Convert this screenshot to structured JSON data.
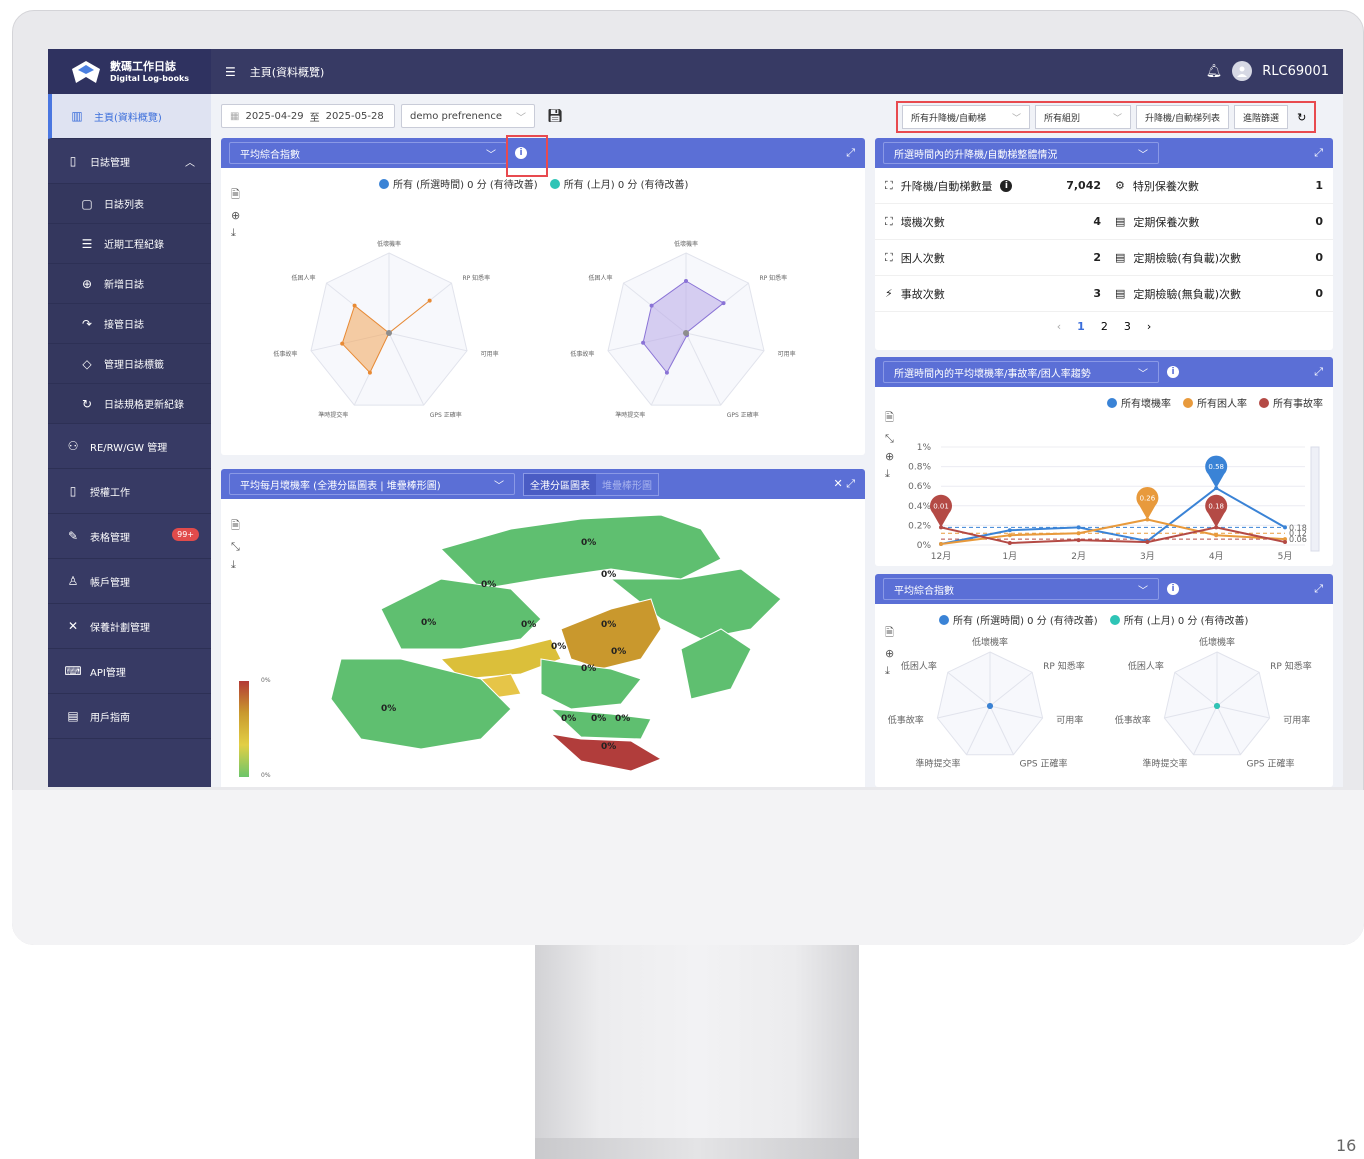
{
  "brand": {
    "title": "數碼工作日誌",
    "subtitle": "Digital Log-books"
  },
  "header": {
    "page_title": "主頁(資料概覽)",
    "user": "RLC69001"
  },
  "sidebar": {
    "items": [
      {
        "label": "主頁(資料概覽)"
      },
      {
        "label": "日誌管理"
      },
      {
        "label": "日誌列表"
      },
      {
        "label": "近期工程紀錄"
      },
      {
        "label": "新增日誌"
      },
      {
        "label": "接管日誌"
      },
      {
        "label": "管理日誌標籤"
      },
      {
        "label": "日誌規格更新紀錄"
      },
      {
        "label": "RE/RW/GW 管理"
      },
      {
        "label": "授權工作"
      },
      {
        "label": "表格管理"
      },
      {
        "label": "帳戶管理"
      },
      {
        "label": "保養計劃管理"
      },
      {
        "label": "API管理"
      },
      {
        "label": "用戶指南"
      }
    ],
    "forms_badge": "99+"
  },
  "toolbar": {
    "date_from": "2025-04-29",
    "date_sep": "至",
    "date_to": "2025-05-28",
    "preference": "demo prefrenence"
  },
  "filters": {
    "lift": "所有升降機/自動梯",
    "group": "所有組別",
    "list_btn": "升降機/自動梯列表",
    "advanced": "進階篩選"
  },
  "radar_panel": {
    "title": "平均綜合指數",
    "legend_a": "所有 (所選時間) 0 分 (有待改善)",
    "legend_b": "所有 (上月) 0 分 (有待改善)",
    "axes": [
      "低壞機率",
      "RP 知悉率",
      "可用率",
      "GPS 正確率",
      "準時提交率",
      "低事故率",
      "低困人率"
    ]
  },
  "map_panel": {
    "title": "平均每月壞機率 (全港分區圖表 | 堆疊棒形圖)",
    "tab_map": "全港分區圖表",
    "tab_bar": "堆疊棒形圖",
    "scale_top": "0%",
    "scale_bottom": "0%",
    "region_label": "0%"
  },
  "summary_panel": {
    "title": "所選時間內的升降機/自動梯整體情況",
    "rows": [
      {
        "l": "升降機/自動梯數量",
        "v": "7,042",
        "r": "特別保養次數",
        "rv": "1"
      },
      {
        "l": "壞機次數",
        "v": "4",
        "r": "定期保養次數",
        "rv": "0"
      },
      {
        "l": "困人次數",
        "v": "2",
        "r": "定期檢驗(有負載)次數",
        "rv": "0"
      },
      {
        "l": "事故次數",
        "v": "3",
        "r": "定期檢驗(無負載)次數",
        "rv": "0"
      }
    ],
    "pages": [
      "1",
      "2",
      "3"
    ]
  },
  "trend_panel": {
    "title": "所選時間內的平均壞機率/事故率/困人率趨勢",
    "legend": [
      "所有壞機率",
      "所有困人率",
      "所有事故率"
    ],
    "right_labels": [
      "0.18",
      "0.12",
      "0.06"
    ],
    "pins": [
      "0.58",
      "0.26",
      "0.18",
      "0.01"
    ]
  },
  "radar2_panel": {
    "title": "平均綜合指數",
    "legend_a": "所有 (所選時間) 0 分 (有待改善)",
    "legend_b": "所有 (上月) 0 分 (有待改善)"
  },
  "chart_data": {
    "type": "line",
    "title": "所選時間內的平均壞機率/事故率/困人率趨勢",
    "categories": [
      "12月",
      "1月",
      "2月",
      "3月",
      "4月",
      "5月"
    ],
    "y_ticks": [
      "0%",
      "0.2%",
      "0.4%",
      "0.6%",
      "0.8%",
      "1%"
    ],
    "ylim": [
      0,
      1
    ],
    "series": [
      {
        "name": "所有壞機率",
        "color": "#3a83d6",
        "values": [
          0.01,
          0.15,
          0.18,
          0.04,
          0.58,
          0.18
        ]
      },
      {
        "name": "所有困人率",
        "color": "#e89a3c",
        "values": [
          0.01,
          0.1,
          0.12,
          0.26,
          0.1,
          0.06
        ]
      },
      {
        "name": "所有事故率",
        "color": "#b44a45",
        "values": [
          0.18,
          0.02,
          0.05,
          0.03,
          0.18,
          0.03
        ]
      }
    ],
    "ref_lines": [
      0.18,
      0.12,
      0.06
    ],
    "legend_position": "top-right"
  },
  "page_number": "16"
}
